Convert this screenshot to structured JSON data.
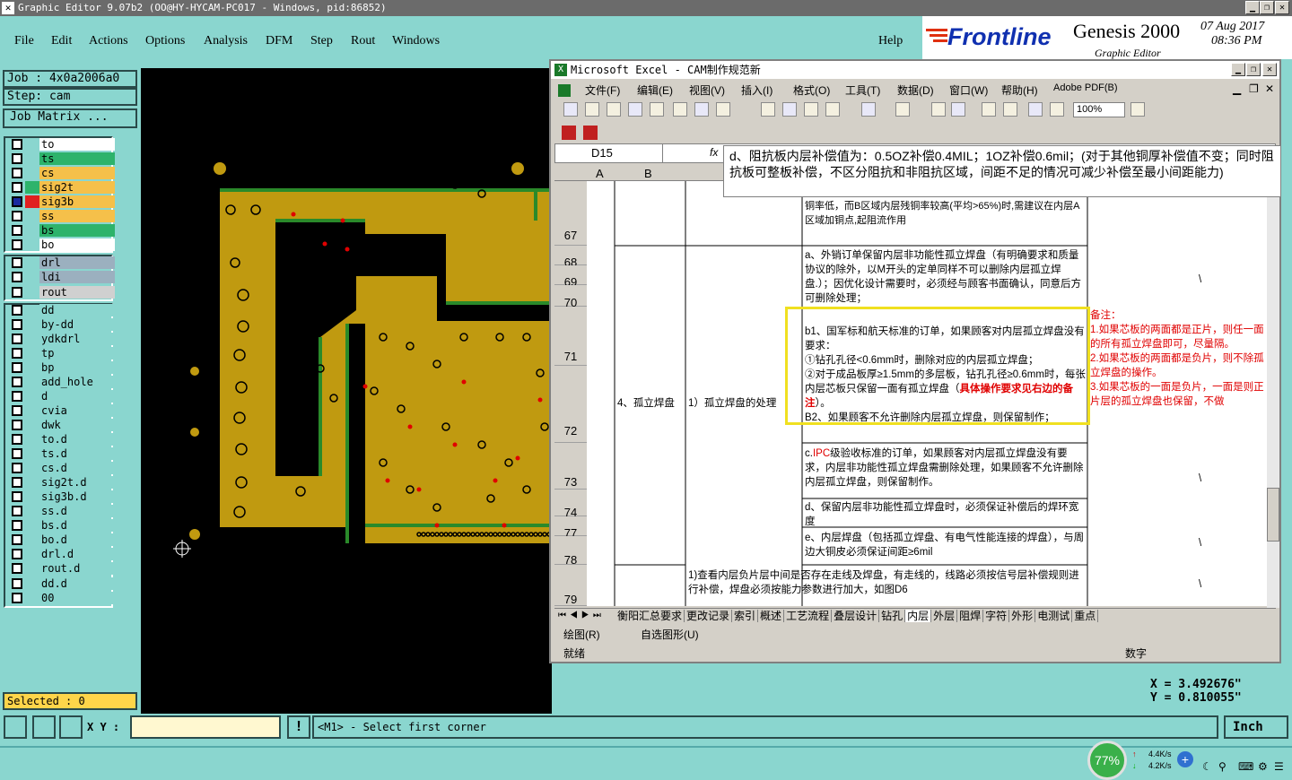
{
  "genesis": {
    "title": "Graphic Editor 9.07b2 (OO@HY-HYCAM-PC017 - Windows, pid:86852)",
    "menu": [
      "File",
      "Edit",
      "Actions",
      "Options",
      "Analysis",
      "DFM",
      "Step",
      "Rout",
      "Windows"
    ],
    "help": "Help",
    "brand": "Frontline",
    "product": "Genesis 2000",
    "product_sub": "Graphic Editor",
    "date": "07 Aug 2017",
    "time": "08:36 PM",
    "job": "Job : 4x0a2006a0",
    "step": "Step: cam",
    "job_matrix": "Job Matrix ...",
    "layers": [
      {
        "name": "to",
        "color": "#ffffff",
        "mark": "✐"
      },
      {
        "name": "ts",
        "color": "#2db36b",
        "mark": ""
      },
      {
        "name": "cs",
        "color": "#f5c04a",
        "mark": ""
      },
      {
        "name": "sig2t",
        "color": "#f5c04a",
        "mark": ""
      },
      {
        "name": "sig3b",
        "color": "#f5c04a",
        "mark": "⊞"
      },
      {
        "name": "ss",
        "color": "#f5c04a",
        "mark": ""
      },
      {
        "name": "bs",
        "color": "#2db36b",
        "mark": ""
      },
      {
        "name": "bo",
        "color": "#ffffff",
        "mark": ""
      },
      {
        "name": "drl",
        "color": "#9bb0bf",
        "mark": ""
      },
      {
        "name": "ldi",
        "color": "#9bb0bf",
        "mark": ""
      },
      {
        "name": "rout",
        "color": "#d0d0d0",
        "mark": ""
      },
      {
        "name": "dd",
        "color": "#8ad6cf",
        "mark": "✐"
      },
      {
        "name": "by-dd",
        "color": "#8ad6cf",
        "mark": ""
      },
      {
        "name": "ydkdrl",
        "color": "#8ad6cf",
        "mark": ""
      },
      {
        "name": "tp",
        "color": "#8ad6cf",
        "mark": ""
      },
      {
        "name": "bp",
        "color": "#8ad6cf",
        "mark": ""
      },
      {
        "name": "add_hole",
        "color": "#8ad6cf",
        "mark": ""
      },
      {
        "name": "d",
        "color": "#8ad6cf",
        "mark": ""
      },
      {
        "name": "cvia",
        "color": "#8ad6cf",
        "mark": ""
      },
      {
        "name": "dwk",
        "color": "#8ad6cf",
        "mark": ""
      },
      {
        "name": "to.d",
        "color": "#8ad6cf",
        "mark": "✐"
      },
      {
        "name": "ts.d",
        "color": "#8ad6cf",
        "mark": ""
      },
      {
        "name": "cs.d",
        "color": "#8ad6cf",
        "mark": ""
      },
      {
        "name": "sig2t.d",
        "color": "#8ad6cf",
        "mark": ""
      },
      {
        "name": "sig3b.d",
        "color": "#8ad6cf",
        "mark": ""
      },
      {
        "name": "ss.d",
        "color": "#8ad6cf",
        "mark": ""
      },
      {
        "name": "bs.d",
        "color": "#8ad6cf",
        "mark": ""
      },
      {
        "name": "bo.d",
        "color": "#8ad6cf",
        "mark": ""
      },
      {
        "name": "drl.d",
        "color": "#8ad6cf",
        "mark": ""
      },
      {
        "name": "rout.d",
        "color": "#8ad6cf",
        "mark": ""
      },
      {
        "name": "dd.d",
        "color": "#8ad6cf",
        "mark": "✐"
      },
      {
        "name": "00",
        "color": "#8ad6cf",
        "mark": ""
      }
    ],
    "selected": "Selected : 0",
    "coord_x": "X = 3.492676\"",
    "coord_y": "Y = 0.810055\"",
    "xy_label": "X Y :",
    "xy_value": "",
    "prompt": "<M1> - Select first corner",
    "units": "Inch"
  },
  "excel": {
    "title": "Microsoft Excel - CAM制作规范新",
    "menu": [
      "文件(F)",
      "编辑(E)",
      "视图(V)",
      "插入(I)",
      "格式(O)",
      "工具(T)",
      "数据(D)",
      "窗口(W)",
      "帮助(H)",
      "Adobe PDF(B)"
    ],
    "zoom": "100%",
    "name_box": "D15",
    "fx": "fx",
    "formula": "d、阻抗板内层补偿值为：0.5OZ补偿0.4MIL；1OZ补偿0.6mil；(对于其他铜厚补偿值不变；同时阻抗板可整板补偿，不区分阻抗和非阻抗区域，间距不足的情况可减少补偿至最小间距能力)",
    "col_headers": [
      "A",
      "B"
    ],
    "row_numbers": [
      "67",
      "68",
      "69",
      "70",
      "71",
      "72",
      "73",
      "74",
      "77",
      "78",
      "79"
    ],
    "cells": {
      "r67d": "1、内层线路分布不均匀，如附图B5较A区域内层至为基材或残铜率低，而B区域内层残铜率较高(平均>65%)时,需建议在内层A区域加铜点,起阻流作用",
      "b_item": "4、孤立焊盘",
      "c_item": "1）孤立焊盘的处理",
      "r68d": "a、外销订单保留内层非功能性孤立焊盘（有明确要求和质量协议的除外，以M开头的定单同样不可以删除内层孤立焊盘.）；因优化设计需要时，必须经与顾客书面确认，同意后方可删除处理；",
      "r68e": "\\",
      "r71d_1": "b1、国军标和航天标准的订单，如果顾客对内层孤立焊盘没有要求：",
      "r71d_2": "①钻孔孔径<0.6mm时，删除对应的内层孤立焊盘；",
      "r71d_3": "②对于成品板厚≥1.5mm的多层板，钻孔孔径≥0.6mm时，每张内层芯板只保留一面有孤立焊盘（",
      "r71d_red": "具体操作要求见右边的备注",
      "r71d_4": "）。",
      "r71d_5": "B2、如果顾客不允许删除内层孤立焊盘，则保留制作；",
      "r71e": "备注：\n1.如果芯板的两面都是正片，则任一面的所有孤立焊盘即可，尽量隔。\n2.如果芯板的两面都是负片，则不除孤立焊盘的操作。\n3.如果芯板的一面是负片，一面是则正片层的孤立焊盘也保留，不做",
      "r73d_1": "c.",
      "r73d_ipc": "IPC",
      "r73d_2": "级验收标准的订单，如果顾客对内层孤立焊盘没有要求，内层非功能性孤立焊盘需删除处理，如果顾客不允许删除内层孤立焊盘，则保留制作。",
      "r73e": "\\",
      "r74d": "d、保留内层非功能性孤立焊盘时，必须保证补偿后的焊环宽度",
      "r77d": "e、内层焊盘（包括孤立焊盘、有电气性能连接的焊盘），与周边大铜皮必须保证间距≥6mil",
      "r77e": "\\",
      "r79cd": "1)查看内层负片层中间是否存在走线及焊盘，有走线的，线路必须按信号层补偿规则进行补偿，焊盘必须按能力参数进行加大，如图D6",
      "r79e": "\\"
    },
    "sheet_tabs": [
      "衡阳汇总要求",
      "更改记录",
      "索引",
      "概述",
      "工艺流程",
      "叠层设计",
      "钻孔",
      "内层",
      "外层",
      "阻焊",
      "字符",
      "外形",
      "电测试",
      "重点"
    ],
    "active_tab": "内层",
    "draw_label": "绘图(R)",
    "autoshape_label": "自选图形(U)",
    "status": "就绪",
    "status_right": "数字"
  },
  "taskbar": {
    "cpu": "77%",
    "up": "4.4K/s",
    "down": "4.2K/s"
  }
}
